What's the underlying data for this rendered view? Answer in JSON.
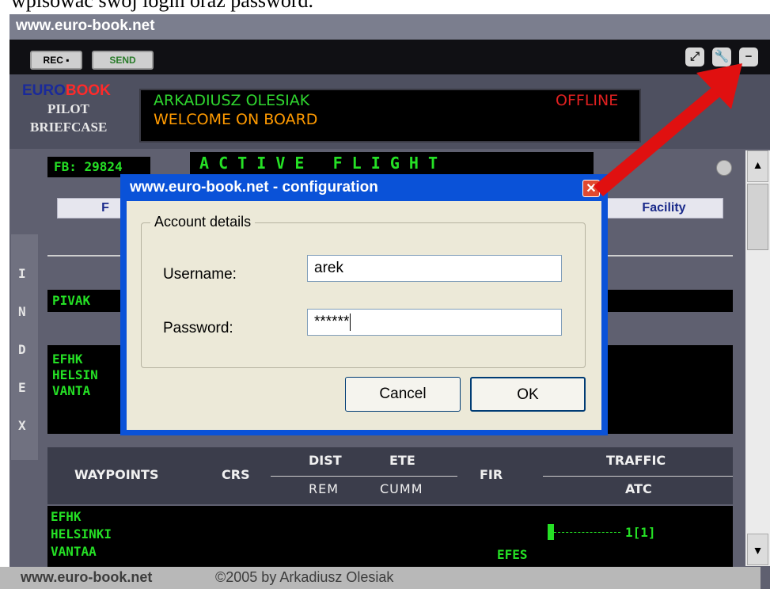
{
  "caption": "wpisować swój login oraz password.",
  "app": {
    "title": "www.euro-book.net",
    "toolbar": {
      "rec_label": "REC ▪",
      "send_label": "SEND"
    },
    "brand": {
      "euro": "EURO",
      "book": "BOOK",
      "pilot": "PILOT",
      "briefcase": "BRIEFCASE"
    },
    "display": {
      "pilot_name": "ARKADIUSZ OLESIAK",
      "status": "OFFLINE",
      "welcome": "WELCOME ON BOARD"
    },
    "fb_number": "FB: 29824",
    "active_flight": "A C T I V E   F L I G H T",
    "facility_label": "Facility",
    "left_button_fragment": "F",
    "route_fragment": "PIVAK",
    "origin_lines": [
      "EFHK",
      "HELSIN",
      "VANTA"
    ],
    "index_letters": [
      "I",
      "N",
      "D",
      "E",
      "X"
    ],
    "waypoints_table": {
      "headers": {
        "waypoints": "WAYPOINTS",
        "crs": "CRS",
        "dist": "DIST",
        "rem": "REM",
        "ete": "ETE",
        "cumm": "CUMM",
        "fir": "FIR",
        "traffic": "TRAFFIC",
        "atc": "ATC"
      },
      "rows": [
        {
          "lines": [
            "EFHK",
            "HELSINKI",
            "VANTAA"
          ],
          "fir": "EFES",
          "traffic": "1[1]"
        }
      ]
    },
    "footer": {
      "site": "www.euro-book.net",
      "copyright": "©2005 by Arkadiusz Olesiak"
    }
  },
  "dialog": {
    "title": "www.euro-book.net - configuration",
    "group_label": "Account details",
    "username_label": "Username:",
    "username_value": "arek",
    "password_label": "Password:",
    "password_value": "******",
    "cancel_label": "Cancel",
    "ok_label": "OK"
  },
  "colors": {
    "annotation_arrow": "#e01010",
    "lcd_green": "#25e025",
    "dialog_blue": "#0a52d8"
  }
}
